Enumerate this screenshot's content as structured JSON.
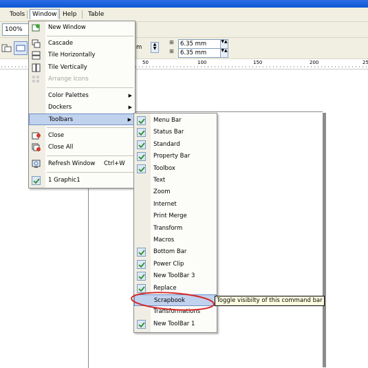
{
  "menubar": {
    "items": [
      {
        "label": "Tools"
      },
      {
        "label": "Window"
      },
      {
        "label": "Help"
      },
      {
        "label": "Table"
      }
    ]
  },
  "toolbar": {
    "zoom": "100%"
  },
  "propbar": {
    "x_value": "6.35 mm",
    "y_value": "6.35 mm",
    "partial_unit": "m"
  },
  "ruler": {
    "ticks": [
      "50",
      "100",
      "150",
      "200",
      "25"
    ]
  },
  "window_menu": {
    "items": [
      {
        "label": "New Window",
        "icon": "new-window-icon"
      },
      {
        "label": "Cascade",
        "icon": "cascade-icon"
      },
      {
        "label": "Tile Horizontally",
        "icon": "tile-horizontal-icon"
      },
      {
        "label": "Tile Vertically",
        "icon": "tile-vertical-icon"
      },
      {
        "label": "Arrange Icons",
        "icon": "arrange-icons-icon",
        "disabled": true
      },
      {
        "label": "Color Palettes",
        "submenu": true
      },
      {
        "label": "Dockers",
        "submenu": true
      },
      {
        "label": "Toolbars",
        "submenu": true,
        "highlighted": true
      },
      {
        "label": "Close",
        "icon": "close-doc-icon"
      },
      {
        "label": "Close All",
        "icon": "close-all-icon"
      },
      {
        "label": "Refresh Window",
        "icon": "refresh-icon",
        "shortcut": "Ctrl+W"
      },
      {
        "label": "1 Graphic1",
        "checked": true
      }
    ]
  },
  "toolbars_menu": {
    "items": [
      {
        "label": "Menu Bar",
        "checked": true
      },
      {
        "label": "Status Bar",
        "checked": true
      },
      {
        "label": "Standard",
        "checked": true
      },
      {
        "label": "Property Bar",
        "checked": true
      },
      {
        "label": "Toolbox",
        "checked": true
      },
      {
        "label": "Text",
        "checked": false
      },
      {
        "label": "Zoom",
        "checked": false
      },
      {
        "label": "Internet",
        "checked": false
      },
      {
        "label": "Print Merge",
        "checked": false
      },
      {
        "label": "Transform",
        "checked": false
      },
      {
        "label": "Macros",
        "checked": false
      },
      {
        "label": "Bottom Bar",
        "checked": true
      },
      {
        "label": "Power Clip",
        "checked": true
      },
      {
        "label": "New ToolBar 3",
        "checked": true
      },
      {
        "label": "Replace",
        "checked": true
      },
      {
        "label": "Scrapbook",
        "checked": false,
        "highlighted": true
      },
      {
        "label": "Transformations",
        "checked": false
      },
      {
        "label": "New ToolBar 1",
        "checked": true
      }
    ]
  },
  "tooltip": {
    "text": "Toggle visibilty of this command bar"
  },
  "colors": {
    "highlight": "#c1d2ee",
    "annotation": "#d42c2c",
    "check": "#2f8f2f"
  }
}
